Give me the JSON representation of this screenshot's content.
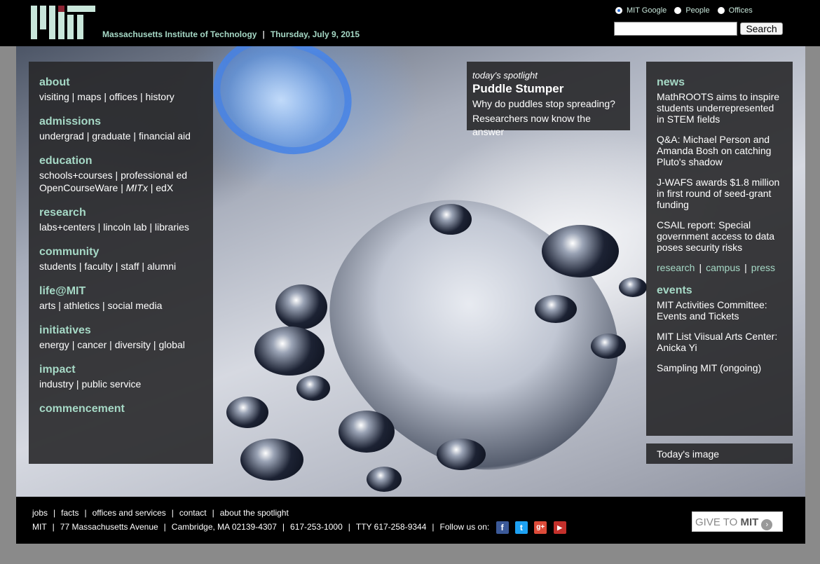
{
  "header": {
    "institution": "Massachusetts Institute of Technology",
    "date": "Thursday, July 9, 2015",
    "radios": [
      {
        "label": "MIT Google",
        "checked": true
      },
      {
        "label": "People",
        "checked": false
      },
      {
        "label": "Offices",
        "checked": false
      }
    ],
    "search_placeholder": "",
    "search_label": "Search"
  },
  "left_menu": [
    {
      "title": "about",
      "lines": [
        [
          "visiting",
          "maps",
          "offices",
          "history"
        ]
      ]
    },
    {
      "title": "admissions",
      "lines": [
        [
          "undergrad",
          "graduate",
          "financial aid"
        ]
      ]
    },
    {
      "title": "education",
      "lines": [
        [
          "schools+courses",
          "professional ed"
        ],
        [
          "OpenCourseWare",
          "MITx",
          "edX"
        ]
      ]
    },
    {
      "title": "research",
      "lines": [
        [
          "labs+centers",
          "lincoln lab",
          "libraries"
        ]
      ]
    },
    {
      "title": "community",
      "lines": [
        [
          "students",
          "faculty",
          "staff",
          "alumni"
        ]
      ]
    },
    {
      "title": "life@MIT",
      "lines": [
        [
          "arts",
          "athletics",
          "social media"
        ]
      ]
    },
    {
      "title": "initiatives",
      "lines": [
        [
          "energy",
          "cancer",
          "diversity",
          "global"
        ]
      ]
    },
    {
      "title": "impact",
      "lines": [
        [
          "industry",
          "public service"
        ]
      ]
    },
    {
      "title": "commencement",
      "lines": []
    }
  ],
  "spotlight": {
    "kicker": "today's spotlight",
    "title": "Puddle Stumper",
    "line1": "Why do puddles stop spreading?",
    "line2": "Researchers now know the answer"
  },
  "news": {
    "title": "news",
    "items": [
      "MathROOTS aims to inspire students underrepresented in STEM fields",
      "Q&A: Michael Person and Amanda Bosh on catching Pluto's shadow",
      "J-WAFS awards $1.8 million in first round of seed-grant funding",
      "CSAIL report: Special government access to data poses security risks"
    ],
    "links": [
      "research",
      "campus",
      "press"
    ]
  },
  "events": {
    "title": "events",
    "items": [
      "MIT Activities Committee: Events and Tickets",
      "MIT List Viisual Arts Center: Anicka Yi",
      "Sampling MIT (ongoing)"
    ]
  },
  "today_image": "Today's image",
  "footer": {
    "row1": [
      "jobs",
      "facts",
      "offices and services",
      "contact",
      "about the spotlight"
    ],
    "row2": [
      "MIT",
      "77 Massachusetts Avenue",
      "Cambridge, MA 02139-4307",
      "617-253-1000",
      "TTY 617-258-9344"
    ],
    "follow": "Follow us on:",
    "social": [
      {
        "name": "facebook",
        "glyph": "f",
        "color": "#3b5998"
      },
      {
        "name": "twitter",
        "glyph": "t",
        "color": "#1da1f2"
      },
      {
        "name": "google-plus",
        "glyph": "g+",
        "color": "#dd4b39"
      },
      {
        "name": "youtube",
        "glyph": "▶",
        "color": "#c4302b"
      }
    ],
    "give_prefix": "GIVE TO",
    "give_strong": "MIT"
  },
  "colors": {
    "accent": "#a6d9c6",
    "panel": "#28282a"
  }
}
